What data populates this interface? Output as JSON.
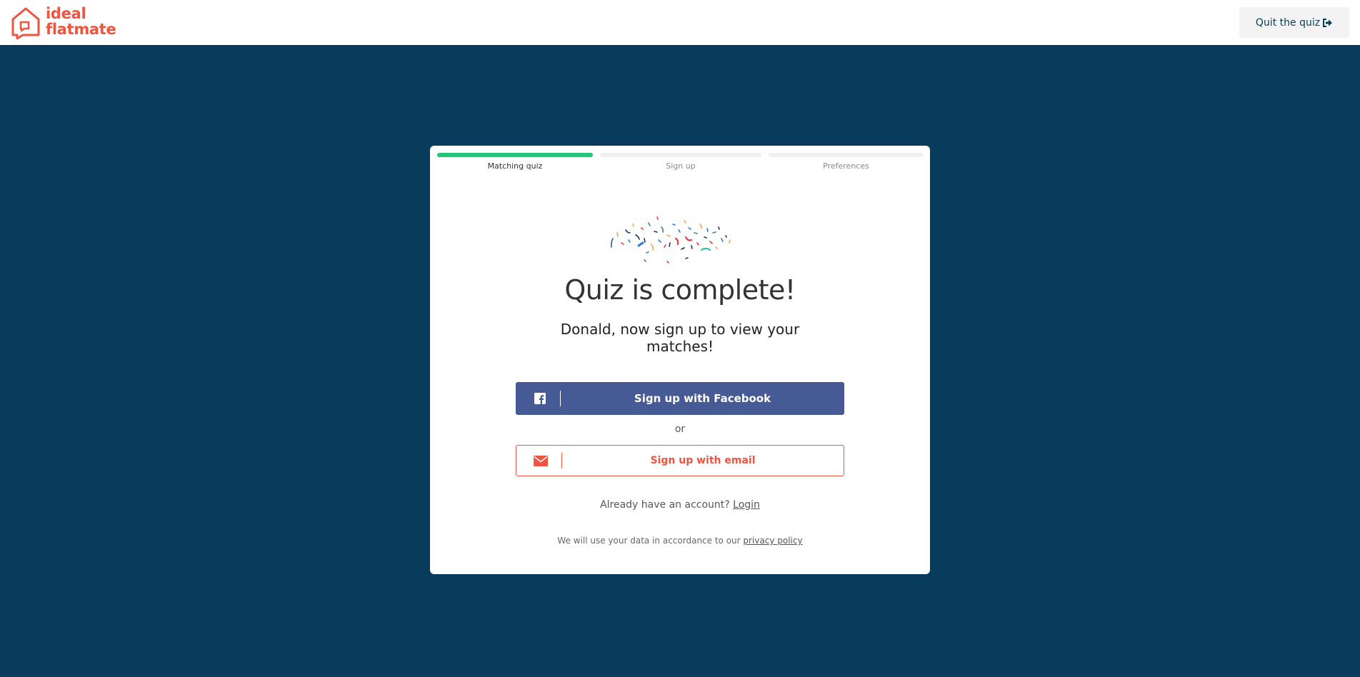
{
  "header": {
    "logo": {
      "line1": "ideal",
      "line2": "flatmate",
      "icon": "house-speech-bubble-icon",
      "brand_color": "#f0533f"
    },
    "quit_button": {
      "label": "Quit the quiz",
      "icon": "sign-out-icon"
    }
  },
  "progress": {
    "steps": [
      {
        "label": "Matching quiz",
        "complete": true
      },
      {
        "label": "Sign up",
        "complete": false
      },
      {
        "label": "Preferences",
        "complete": false
      }
    ],
    "active_color": "#23c677"
  },
  "main": {
    "illustration": "confetti",
    "title": "Quiz is complete!",
    "subtitle": "Donald, now sign up to view your matches!",
    "facebook_button": {
      "label": "Sign up with Facebook",
      "icon": "facebook-icon",
      "color": "#465b95"
    },
    "or_text": "or",
    "email_button": {
      "label": "Sign up with email",
      "icon": "envelope-icon",
      "color": "#f0533f"
    },
    "account_prompt": "Already have an account?",
    "login_link": "Login",
    "privacy_text": "We will use your data in accordance to our",
    "privacy_link": "privacy policy"
  },
  "colors": {
    "background": "#083b5c",
    "card": "#ffffff"
  }
}
